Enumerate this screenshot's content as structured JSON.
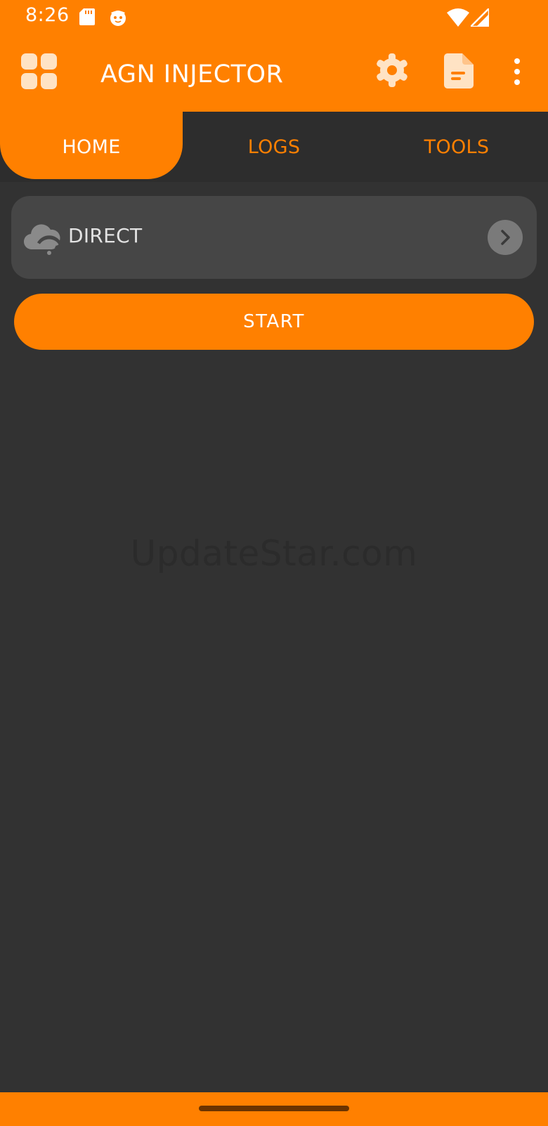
{
  "status_bar": {
    "time": "8:26",
    "icons": [
      "sd-card-icon",
      "cat-icon",
      "wifi-icon",
      "signal-icon"
    ]
  },
  "app_bar": {
    "title": "AGN INJECTOR",
    "icons": [
      "apps-grid-icon",
      "gear-icon",
      "document-icon",
      "more-vert-icon"
    ]
  },
  "tabs": [
    {
      "label": "HOME",
      "selected": true
    },
    {
      "label": "LOGS",
      "selected": false
    },
    {
      "label": "TOOLS",
      "selected": false
    }
  ],
  "connection": {
    "mode_label": "DIRECT",
    "icon": "cloud-wifi-icon",
    "action_icon": "chevron-right-icon"
  },
  "start_label": "START",
  "watermark": "UpdateStar.com",
  "colors": {
    "accent": "#ff8000",
    "background": "#323232",
    "card": "#464646",
    "tab_strip": "#2d2d2d"
  }
}
